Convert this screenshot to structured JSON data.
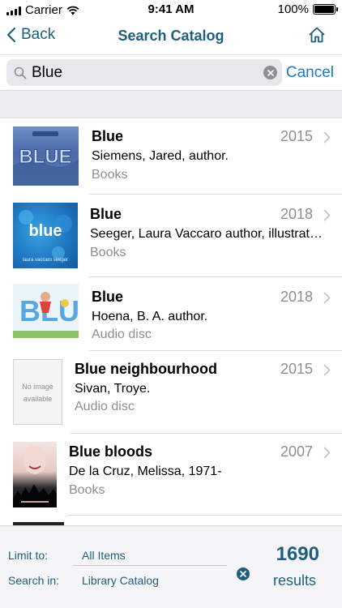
{
  "status_bar": {
    "carrier": "Carrier",
    "time": "9:41 AM",
    "battery": "100%",
    "battery_level": 1.0
  },
  "nav": {
    "back_label": "Back",
    "title": "Search Catalog",
    "home_icon": "home-icon"
  },
  "search": {
    "value": "Blue",
    "cancel_label": "Cancel"
  },
  "results": [
    {
      "title": "Blue",
      "year": "2015",
      "author": "Siemens, Jared, author.",
      "format": "Books",
      "cover": "cover-blue-siemens"
    },
    {
      "title": "Blue",
      "year": "2018",
      "author": "Seeger, Laura Vaccaro author, illustrat…",
      "format": "Books",
      "cover": "cover-blue-seeger",
      "cover_title": "blue",
      "cover_author": "laura vaccaro seeger"
    },
    {
      "title": "Blue",
      "year": "2018",
      "author": "Hoena, B. A. author.",
      "format": "Audio disc",
      "cover": "cover-blue-hoena"
    },
    {
      "title": "Blue neighbourhood",
      "year": "2015",
      "author": "Sivan, Troye.",
      "format": "Audio disc",
      "cover": "no-image",
      "no_image_text": "No image available"
    },
    {
      "title": "Blue bloods",
      "year": "2007",
      "author": "De la Cruz, Melissa, 1971-",
      "format": "Books",
      "cover": "cover-blue-bloods"
    }
  ],
  "footer": {
    "limit_label": "Limit to:",
    "limit_value": "All Items",
    "search_in_label": "Search in:",
    "search_in_value": "Library Catalog",
    "count": "1690",
    "results_label": "results"
  },
  "colors": {
    "accent": "#1f5f7d",
    "link": "#1f78c1",
    "secondary_text": "#8e8e93"
  }
}
